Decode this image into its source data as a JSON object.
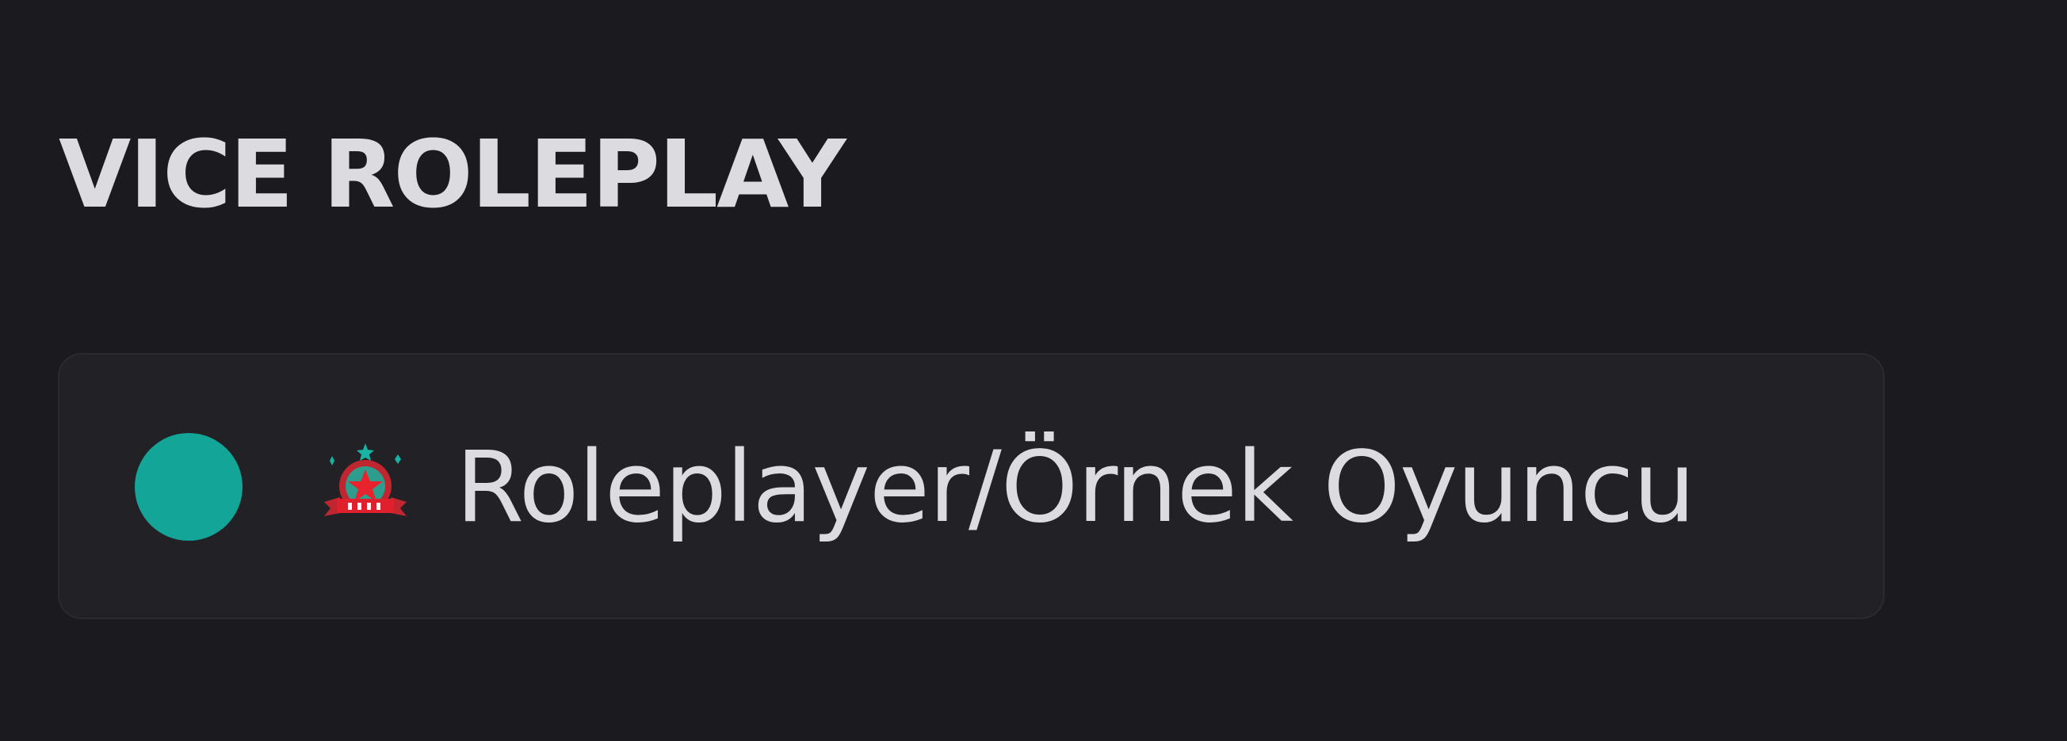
{
  "section": {
    "title": "VICE ROLEPLAY"
  },
  "role": {
    "name": "Roleplayer/Örnek Oyuncu",
    "dot_color": "#13a597",
    "emoji_icon": "star-badge-icon"
  }
}
